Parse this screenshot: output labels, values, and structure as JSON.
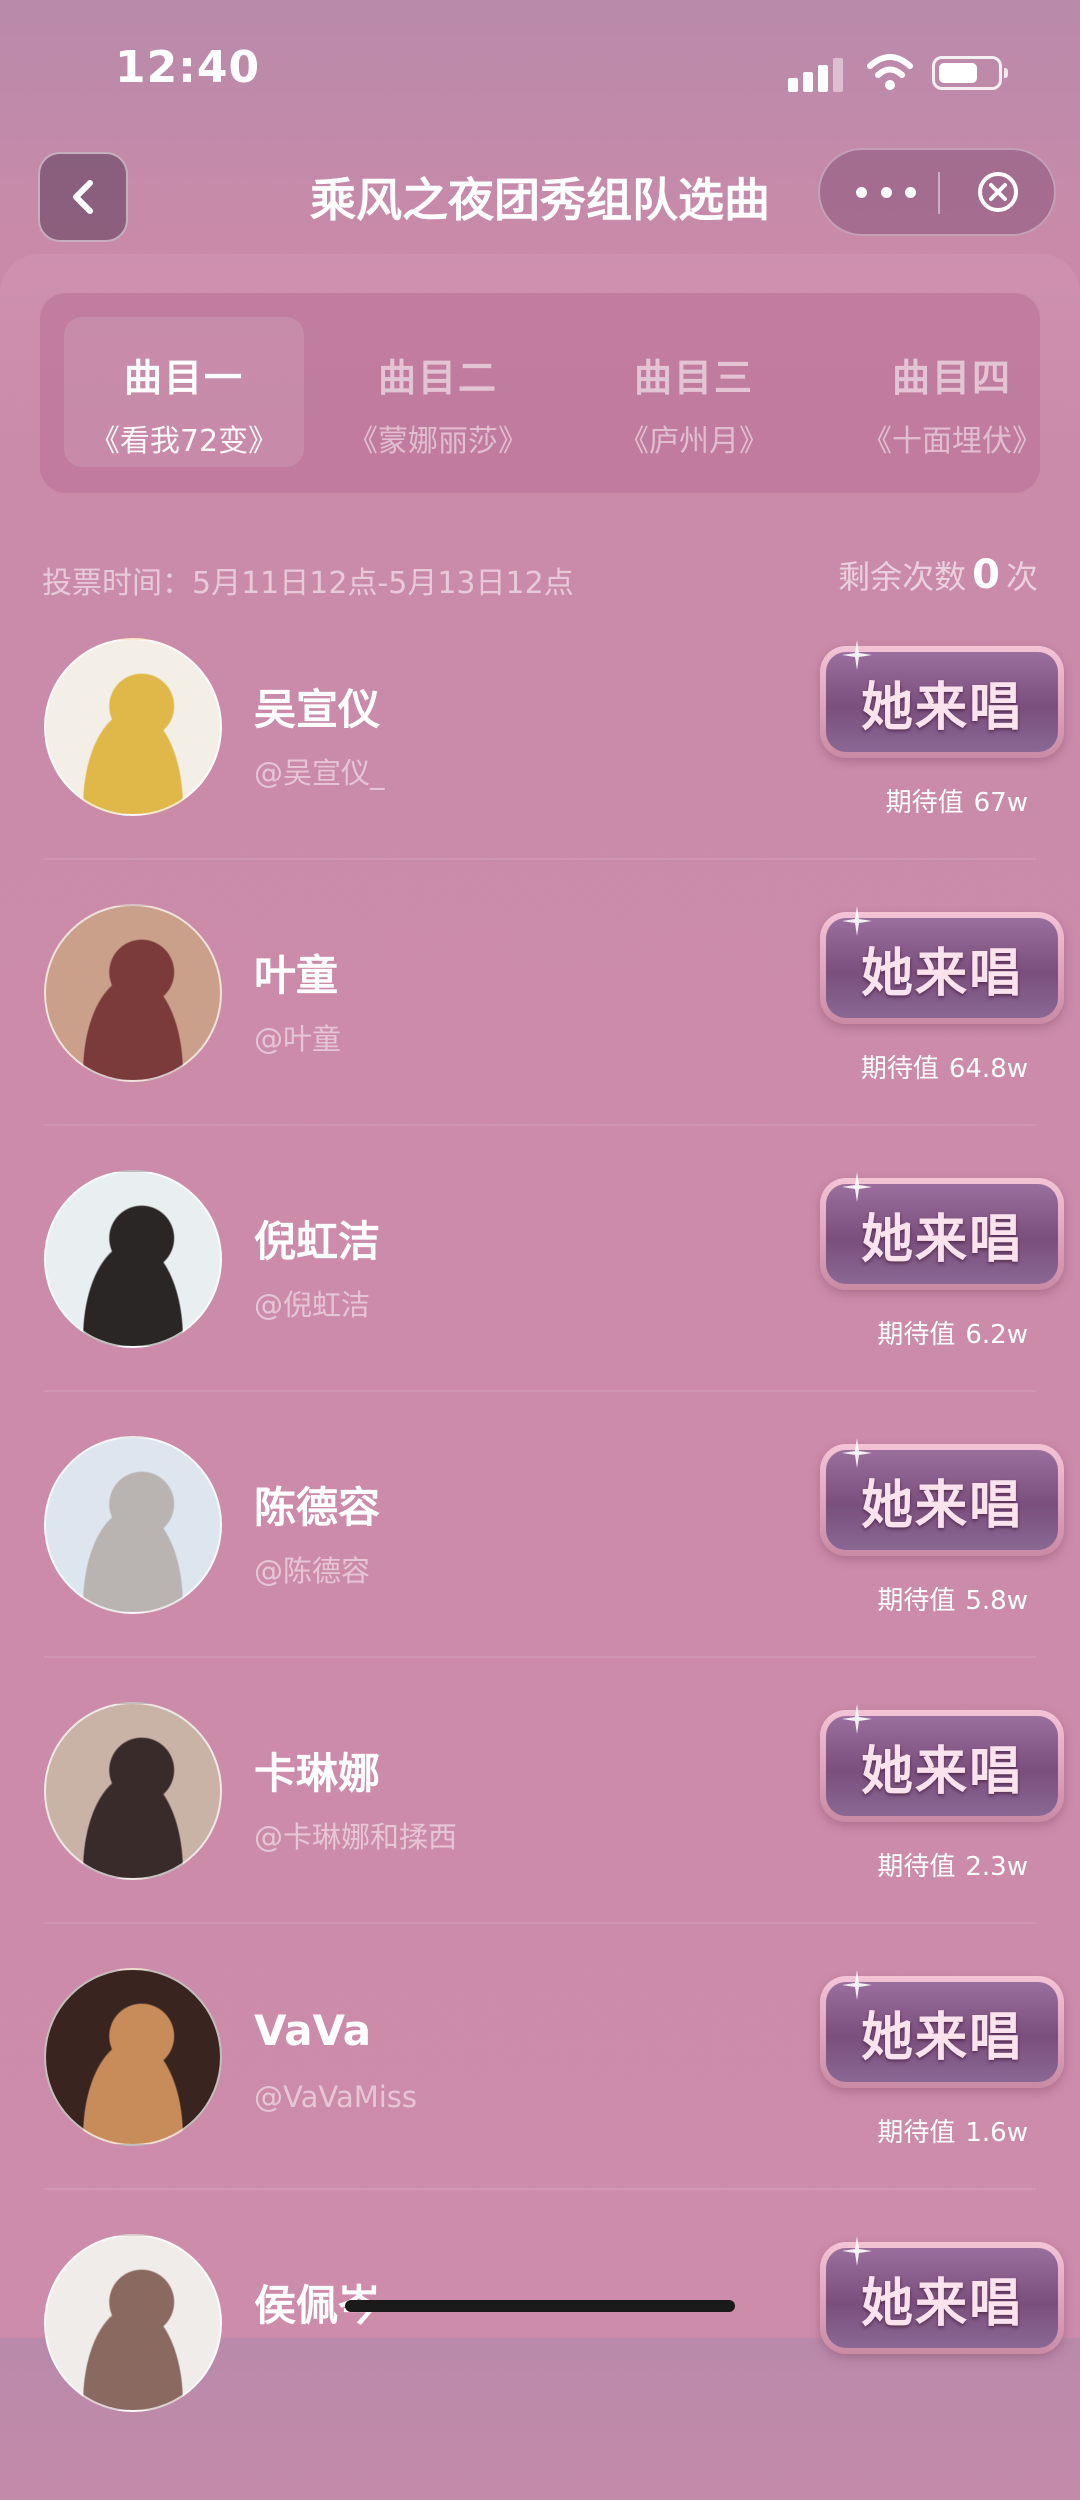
{
  "status_bar": {
    "time": "12:40"
  },
  "nav": {
    "title": "乘风之夜团秀组队选曲"
  },
  "tabs": [
    {
      "label": "曲目一",
      "song": "《看我72变》",
      "active": true
    },
    {
      "label": "曲目二",
      "song": "《蒙娜丽莎》",
      "active": false
    },
    {
      "label": "曲目三",
      "song": "《庐州月》",
      "active": false
    },
    {
      "label": "曲目四",
      "song": "《十面埋伏》",
      "active": false
    }
  ],
  "vote": {
    "time_label": "投票时间：5月11日12点-5月13日12点",
    "remain_prefix": "剩余次数",
    "remain_count": "0",
    "remain_suffix": "次"
  },
  "sing_button_label": "她来唱",
  "expect_label": "期待值",
  "candidates": [
    {
      "name": "吴宣仪",
      "handle": "@吴宣仪_",
      "expect": "67w",
      "avatar_colors": [
        "#f3eee6",
        "#e0b84a"
      ]
    },
    {
      "name": "叶童",
      "handle": "@叶童",
      "expect": "64.8w",
      "avatar_colors": [
        "#caa08b",
        "#7a3b3a"
      ]
    },
    {
      "name": "倪虹洁",
      "handle": "@倪虹洁",
      "expect": "6.2w",
      "avatar_colors": [
        "#e9eef0",
        "#2a2626"
      ]
    },
    {
      "name": "陈德容",
      "handle": "@陈德容",
      "expect": "5.8w",
      "avatar_colors": [
        "#dde6ee",
        "#b9b4b2"
      ]
    },
    {
      "name": "卡琳娜",
      "handle": "@卡琳娜和揉西",
      "expect": "2.3w",
      "avatar_colors": [
        "#c9b3a7",
        "#3a2b2b"
      ]
    },
    {
      "name": "VaVa",
      "handle": "@VaVaMiss",
      "expect": "1.6w",
      "avatar_colors": [
        "#3a2420",
        "#c78c5a"
      ]
    },
    {
      "name": "侯佩岑",
      "handle": "",
      "expect": "",
      "avatar_colors": [
        "#f0ecea",
        "#8a6a60"
      ]
    }
  ]
}
